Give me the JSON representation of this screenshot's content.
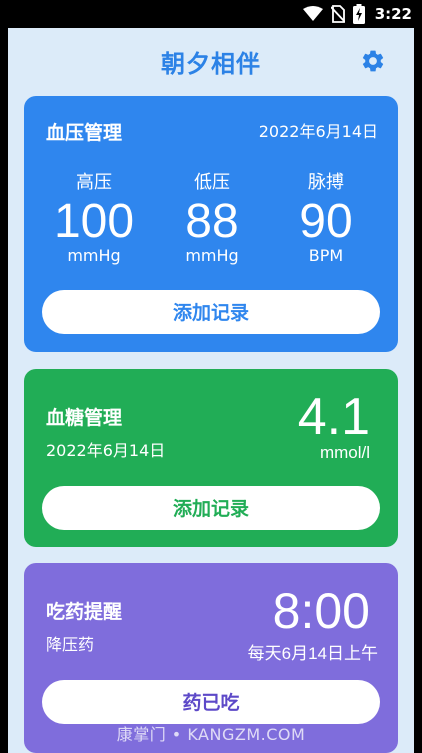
{
  "status_bar": {
    "time": "3:22",
    "icons": [
      "wifi-icon",
      "no-sim-icon",
      "battery-charging-icon"
    ]
  },
  "header": {
    "title": "朝夕相伴",
    "settings_icon": "gear-icon"
  },
  "blood_pressure": {
    "title": "血压管理",
    "date": "2022年6月14日",
    "systolic": {
      "label": "高压",
      "value": "100",
      "unit": "mmHg"
    },
    "diastolic": {
      "label": "低压",
      "value": "88",
      "unit": "mmHg"
    },
    "pulse": {
      "label": "脉搏",
      "value": "90",
      "unit": "BPM"
    },
    "add_button": "添加记录",
    "color": "#2f86ee"
  },
  "blood_sugar": {
    "title": "血糖管理",
    "date": "2022年6月14日",
    "value": "4.1",
    "unit": "mmol/l",
    "add_button": "添加记录",
    "color": "#21ad56"
  },
  "medication": {
    "title": "吃药提醒",
    "drug": "降压药",
    "time": "8:00",
    "schedule": "每天6月14日上午",
    "taken_button": "药已吃",
    "color": "#7f6ddc"
  },
  "watermark": "康掌门 • KANGZM.COM"
}
